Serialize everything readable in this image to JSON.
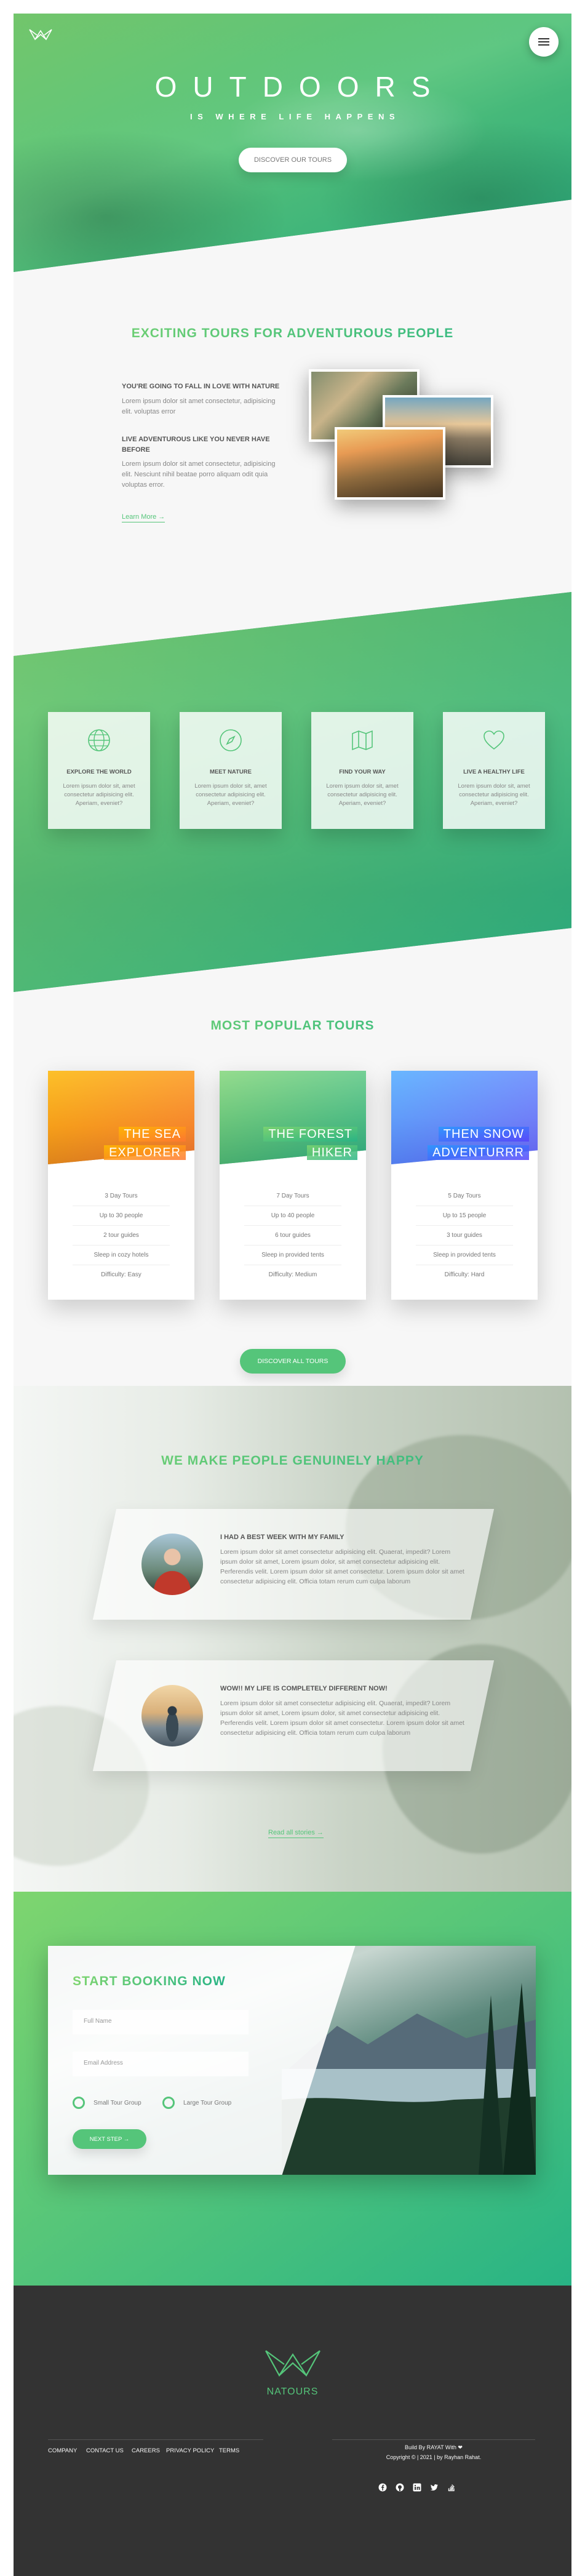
{
  "header": {
    "title": "OUTDOORS",
    "subtitle": "IS WHERE LIFE HAPPENS",
    "cta": "DISCOVER OUR TOURS"
  },
  "about": {
    "title": "EXCITING TOURS FOR ADVENTUROUS PEOPLE",
    "h1": "YOU'RE GOING TO FALL IN LOVE WITH NATURE",
    "p1": "Lorem ipsum dolor sit amet consectetur, adipisicing elit. voluptas error",
    "h2": "LIVE ADVENTUROUS LIKE YOU NEVER HAVE BEFORE",
    "p2": "Lorem ipsum dolor sit amet consectetur, adipisicing elit. Nesciunt nihil beatae porro aliquam odit quia voluptas error.",
    "link": "Learn More →"
  },
  "features": [
    {
      "icon": "globe-icon",
      "title": "EXPLORE THE WORLD",
      "text": "Lorem ipsum dolor sit, amet consectetur adipisicing elit. Aperiam, eveniet?"
    },
    {
      "icon": "compass-icon",
      "title": "MEET NATURE",
      "text": "Lorem ipsum dolor sit, amet consectetur adipisicing elit. Aperiam, eveniet?"
    },
    {
      "icon": "map-icon",
      "title": "FIND YOUR WAY",
      "text": "Lorem ipsum dolor sit, amet consectetur adipisicing elit. Aperiam, eveniet?"
    },
    {
      "icon": "heart-icon",
      "title": "LIVE A HEALTHY LIFE",
      "text": "Lorem ipsum dolor sit, amet consectetur adipisicing elit. Aperiam, eveniet?"
    }
  ],
  "tours": {
    "title": "MOST POPULAR TOURS",
    "cards": [
      {
        "line1": "THE SEA",
        "line2": "EXPLORER",
        "details": [
          "3 Day Tours",
          "Up to 30 people",
          "2 tour guides",
          "Sleep in cozy hotels",
          "Difficulty: Easy"
        ]
      },
      {
        "line1": "THE FOREST",
        "line2": "HIKER",
        "details": [
          "7 Day Tours",
          "Up to 40 people",
          "6 tour guides",
          "Sleep in provided tents",
          "Difficulty: Medium"
        ]
      },
      {
        "line1": "THEN SNOW",
        "line2": "ADVENTURRR",
        "details": [
          "5 Day Tours",
          "Up to 15 people",
          "3 tour guides",
          "Sleep in provided tents",
          "Difficulty: Hard"
        ]
      }
    ],
    "cta": "DISCOVER ALL TOURS"
  },
  "stories": {
    "title": "WE MAKE PEOPLE GENUINELY HAPPY",
    "items": [
      {
        "title": "I HAD A BEST WEEK WITH MY FAMILY",
        "text": "Lorem ipsum dolor sit amet consectetur adipisicing elit. Quaerat, impedit? Lorem ipsum dolor sit amet, Lorem ipsum dolor, sit amet consectetur adipisicing elit. Perferendis velit. Lorem ipsum dolor sit amet consectetur. Lorem ipsum dolor sit amet consectetur adipisicing elit. Officia totam rerum cum culpa laborum"
      },
      {
        "title": "WOW!! MY LIFE IS COMPLETELY DIFFERENT NOW!",
        "text": "Lorem ipsum dolor sit amet consectetur adipisicing elit. Quaerat, impedit? Lorem ipsum dolor sit amet, Lorem ipsum dolor, sit amet consectetur adipisicing elit. Perferendis velit. Lorem ipsum dolor sit amet consectetur. Lorem ipsum dolor sit amet consectetur adipisicing elit. Officia totam rerum cum culpa laborum"
      }
    ],
    "link": "Read all stories →"
  },
  "booking": {
    "title": "START BOOKING NOW",
    "name_placeholder": "Full Name",
    "email_placeholder": "Email Address",
    "radio1": "Small Tour Group",
    "radio2": "Large Tour Group",
    "submit": "NEXT STEP →"
  },
  "footer": {
    "brand": "NATOURS",
    "links": [
      "COMPANY",
      "CONTACT US",
      "CAREERS",
      "PRIVACY POLICY",
      "TERMS"
    ],
    "built_by": "Build By RAYAT With ❤",
    "copyright": "Copyright © | 2021 | by Rayhan Rahat.",
    "social": [
      "facebook-icon",
      "github-icon",
      "linkedin-icon",
      "twitter-icon",
      "stack-overflow-icon"
    ]
  },
  "colors": {
    "primary": "#55c57a",
    "light": "#7ed56f",
    "dark": "#28b485",
    "footer": "#333333"
  }
}
